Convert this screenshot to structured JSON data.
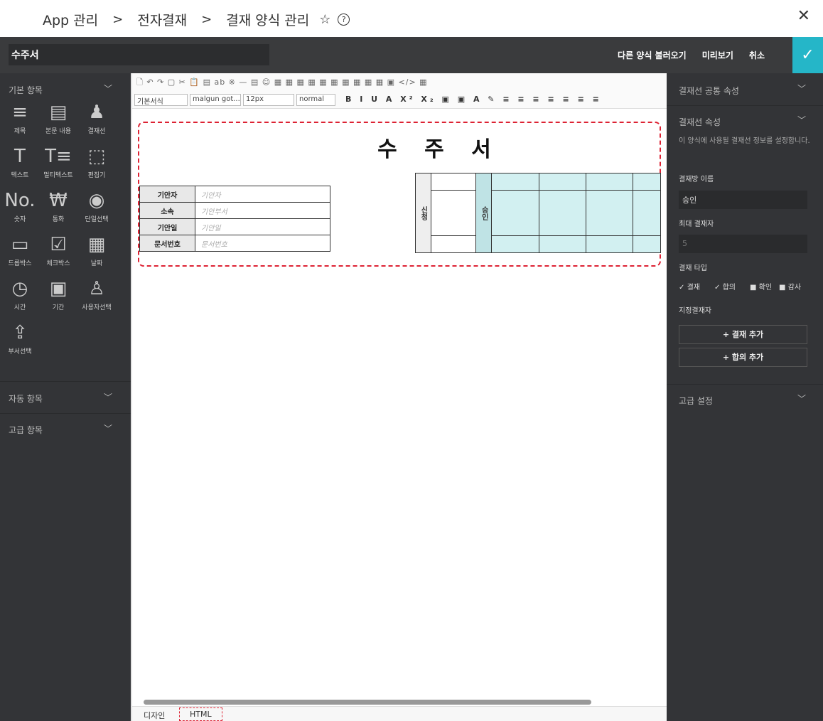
{
  "breadcrumb": {
    "items": [
      "App 관리",
      "전자결재",
      "결재 양식 관리"
    ],
    "sep": ">",
    "star": "☆",
    "help": "?"
  },
  "close": "✕",
  "header": {
    "title_value": "수주서",
    "buttons": [
      "다른 양식 불러오기",
      "미리보기",
      "취소"
    ],
    "confirm": "✓"
  },
  "left": {
    "basic_title": "기본 항목",
    "tools": [
      {
        "icon": "≡",
        "label": "제목"
      },
      {
        "icon": "▤",
        "label": "본문 내용"
      },
      {
        "icon": "♟",
        "label": "결재선"
      },
      {
        "icon": "T",
        "label": "텍스트"
      },
      {
        "icon": "T≡",
        "label": "멀티텍스트"
      },
      {
        "icon": "⬚",
        "label": "편집기"
      },
      {
        "icon": "No.",
        "label": "숫자"
      },
      {
        "icon": "₩",
        "label": "통화"
      },
      {
        "icon": "◉",
        "label": "단일선택"
      },
      {
        "icon": "▭",
        "label": "드롭박스"
      },
      {
        "icon": "☑",
        "label": "체크박스"
      },
      {
        "icon": "▦",
        "label": "날짜"
      },
      {
        "icon": "◷",
        "label": "시간"
      },
      {
        "icon": "▣",
        "label": "기간"
      },
      {
        "icon": "♙",
        "label": "사용자선택"
      },
      {
        "icon": "⇪",
        "label": "부서선택"
      }
    ],
    "auto_title": "자동 항목",
    "adv_title": "고급 항목"
  },
  "editor": {
    "toolbar_row1": "🗋 ↶ ↷ ▢ ✂ 📋 ▤ ab ※ — ▤ ☺ ▦ ▦ ▦ ▦ ▦ ▦ ▦ ▦ ▦ ▦ ▣ </> ▦",
    "font_style": "기본서식",
    "font_name": "malgun got...",
    "font_size": "12px",
    "font_weight": "normal",
    "toolbar_row2": "B I U A X² X₂ ▣ ▣ A ✎ ≡ ≡ ≡ ≡ ≡ ≡ ≡",
    "doc_title": "수 주 서",
    "info": [
      {
        "k": "기안자",
        "v": "기안자"
      },
      {
        "k": "소속",
        "v": "기안부서"
      },
      {
        "k": "기안일",
        "v": "기안일"
      },
      {
        "k": "문서번호",
        "v": "문서번호"
      }
    ],
    "approval": {
      "apply": "신청",
      "approve": "승인"
    },
    "tabs": {
      "design": "디자인",
      "html": "HTML"
    }
  },
  "right": {
    "common_title": "결재선 공통 속성",
    "prop_title": "결재선 속성",
    "desc": "이 양식에 사용될 결재선 정보를 설정합니다.",
    "name_label": "결재방 이름",
    "name_value": "승인",
    "max_label": "최대 결재자",
    "max_value": "5",
    "type_label": "결재 타입",
    "types": [
      {
        "label": "결재",
        "checked": true
      },
      {
        "label": "합의",
        "checked": true
      },
      {
        "label": "확인",
        "checked": false
      },
      {
        "label": "감사",
        "checked": false
      }
    ],
    "assign_label": "지정결재자",
    "add_approval": "+ 결재 추가",
    "add_agree": "+ 합의 추가",
    "adv_title": "고급 설정"
  },
  "colors": {
    "accent": "#25b6c8",
    "panel": "#333437",
    "highlight": "#d2f0f1"
  }
}
